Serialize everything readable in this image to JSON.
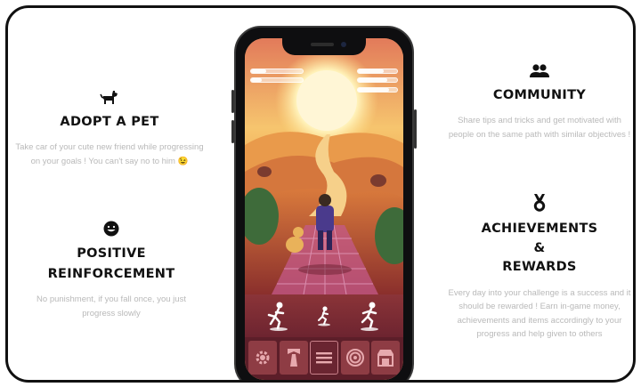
{
  "features": {
    "adopt": {
      "icon": "dog-icon",
      "title": "ADOPT A PET",
      "desc": "Take car of your cute new friend while progressing on your goals ! You can't say no to him 😉"
    },
    "positive": {
      "icon": "smile-icon",
      "title_line1": "POSITIVE",
      "title_line2": "REINFORCEMENT",
      "desc": "No punishment, if you fall once, you just progress slowly"
    },
    "community": {
      "icon": "users-icon",
      "title": "COMMUNITY",
      "desc": "Share tips and tricks and get motivated with people on the same path with similar objectives !"
    },
    "achievements": {
      "icon": "medal-icon",
      "title_line1": "ACHIEVEMENTS",
      "title_line2": "&",
      "title_line3": "REWARDS",
      "desc": "Every day into your challenge is a success and it should be rewarded ! Earn in-game money, achievements and items accordingly to your progress and help given to others"
    }
  },
  "phone": {
    "hud": [
      {
        "name": "left-top",
        "level": 0.3
      },
      {
        "name": "left-bottom",
        "level": 0.2
      },
      {
        "name": "right-1",
        "level": 0.65
      },
      {
        "name": "right-2",
        "level": 0.75
      },
      {
        "name": "right-3",
        "level": 0.8
      }
    ],
    "action_icons": [
      "jump-icon",
      "run-small-icon",
      "run-icon"
    ],
    "tabs": [
      "gear-icon",
      "banner-icon",
      "menu-icon",
      "target-icon",
      "shop-icon"
    ],
    "active_tab": 2
  },
  "colors": {
    "title": "#111111",
    "desc": "#b9b9b9",
    "tab_bg": "#8e3c44",
    "tabbar_bg": "#5c1e29"
  }
}
